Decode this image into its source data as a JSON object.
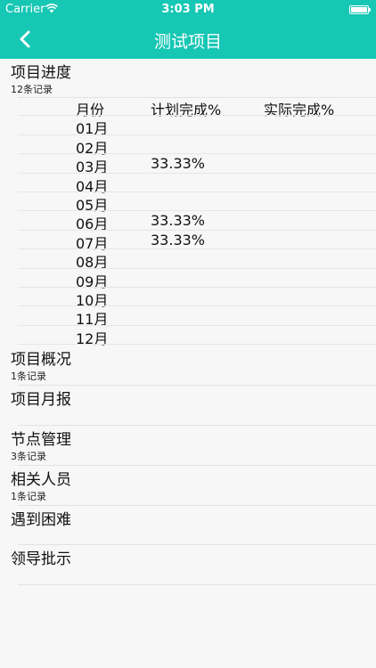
{
  "status_bar": {
    "carrier": "Carrier",
    "time": "3:03 PM"
  },
  "nav": {
    "title": "测试项目",
    "back_icon": "chevron-left-icon"
  },
  "progress": {
    "title": "项目进度",
    "count": "12条记录",
    "columns": [
      "月份",
      "计划完成%",
      "实际完成%"
    ],
    "rows": [
      {
        "month": "01月",
        "plan": "",
        "actual": ""
      },
      {
        "month": "02月",
        "plan": "",
        "actual": ""
      },
      {
        "month": "03月",
        "plan": "33.33%",
        "actual": ""
      },
      {
        "month": "04月",
        "plan": "",
        "actual": ""
      },
      {
        "month": "05月",
        "plan": "",
        "actual": ""
      },
      {
        "month": "06月",
        "plan": "33.33%",
        "actual": ""
      },
      {
        "month": "07月",
        "plan": "33.33%",
        "actual": ""
      },
      {
        "month": "08月",
        "plan": "",
        "actual": ""
      },
      {
        "month": "09月",
        "plan": "",
        "actual": ""
      },
      {
        "month": "10月",
        "plan": "",
        "actual": ""
      },
      {
        "month": "11月",
        "plan": "",
        "actual": ""
      },
      {
        "month": "12月",
        "plan": "",
        "actual": ""
      }
    ]
  },
  "sections": [
    {
      "title": "项目概况",
      "count": "1条记录"
    },
    {
      "title": "项目月报",
      "count": ""
    },
    {
      "title": "节点管理",
      "count": "3条记录"
    },
    {
      "title": "相关人员",
      "count": "1条记录"
    },
    {
      "title": "遇到困难",
      "count": ""
    },
    {
      "title": "领导批示",
      "count": ""
    }
  ],
  "colors": {
    "accent": "#16c7b4",
    "background": "#f7f7f7"
  }
}
